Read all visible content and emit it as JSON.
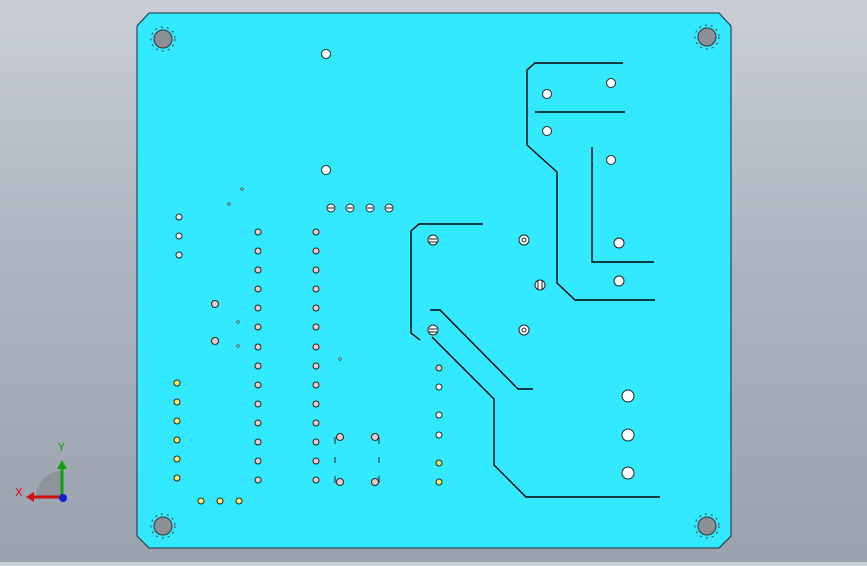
{
  "view": {
    "background_top": "#c9ced6",
    "background_bottom": "#9aa2ae"
  },
  "board": {
    "fill": "#33e9ff",
    "outline": "#1a2a3a",
    "trace": "#000000",
    "pad_white": "#ffffff",
    "pad_pink": "#f2c9c9",
    "pad_yellow": "#ffee66",
    "mount_hole_fill": "#8c9096"
  },
  "triad": {
    "x_label": "X",
    "y_label": "Y",
    "x_color": "#d01010",
    "y_color": "#10a010",
    "z_color": "#1020d0"
  }
}
